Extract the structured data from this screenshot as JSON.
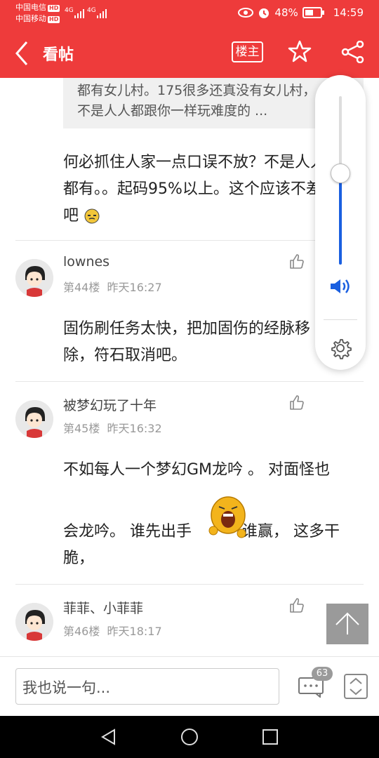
{
  "status": {
    "carrier1": "中国电信",
    "carrier2": "中国移动",
    "hd": "HD",
    "net": "4G",
    "battery": "48%",
    "time": "14:59"
  },
  "header": {
    "title": "看帖",
    "louzhu": "楼主"
  },
  "quote": {
    "line1": "都有女儿村。175很多还真没有女儿村，",
    "line2": "不是人人都跟你一样玩难度的 ..."
  },
  "messages": {
    "m1_line1": "何必抓住人家一点口误不放？不是人人",
    "m1_line2": "都有。。起码95%以上。这个应该不差",
    "m1_line3": "吧"
  },
  "posts": [
    {
      "user": "lownes",
      "floor": "第44楼",
      "time": "昨天16:27",
      "line1": "固伤刷任务太快，把加固伤的经脉移",
      "line2": "除，符石取消吧。"
    },
    {
      "user": "被梦幻玩了十年",
      "floor": "第45楼",
      "time": "昨天16:32",
      "line1": "不如每人一个梦幻GM龙吟 。 对面怪也",
      "line2a": "会龙吟。 谁先出手",
      "line2b": "谁赢， 这多干",
      "line3": "脆，"
    },
    {
      "user": "菲菲、小菲菲",
      "floor": "第46楼",
      "time": "昨天18:17"
    }
  ],
  "bottom": {
    "placeholder": "我也说一句...",
    "comment_count": "63"
  },
  "colors": {
    "brand": "#ee3b3b",
    "volume_accent": "#1a5fe0"
  }
}
